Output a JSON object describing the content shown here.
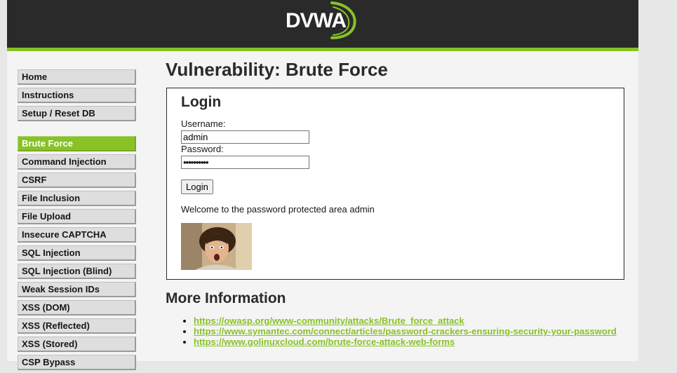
{
  "header": {
    "logo_text": "DVWA",
    "colors": {
      "header_bg": "#2a2a2a",
      "accent": "#88c226",
      "page_bg": "#f4f4f4"
    }
  },
  "menu": {
    "top": [
      "Home",
      "Instructions",
      "Setup / Reset DB"
    ],
    "vulns": [
      "Brute Force",
      "Command Injection",
      "CSRF",
      "File Inclusion",
      "File Upload",
      "Insecure CAPTCHA",
      "SQL Injection",
      "SQL Injection (Blind)",
      "Weak Session IDs",
      "XSS (DOM)",
      "XSS (Reflected)",
      "XSS (Stored)",
      "CSP Bypass"
    ],
    "selected": "Brute Force"
  },
  "main": {
    "title": "Vulnerability: Brute Force",
    "login": {
      "heading": "Login",
      "username_label": "Username:",
      "username_value": "admin",
      "password_label": "Password:",
      "password_value": "••••••••••",
      "button_label": "Login",
      "welcome": "Welcome to the password protected area admin",
      "photo_icon": "user-avatar-photo"
    },
    "more_info": {
      "heading": "More Information",
      "links": [
        "https://owasp.org/www-community/attacks/Brute_force_attack",
        "https://www.symantec.com/connect/articles/password-crackers-ensuring-security-your-password",
        "https://www.golinuxcloud.com/brute-force-attack-web-forms"
      ]
    }
  }
}
